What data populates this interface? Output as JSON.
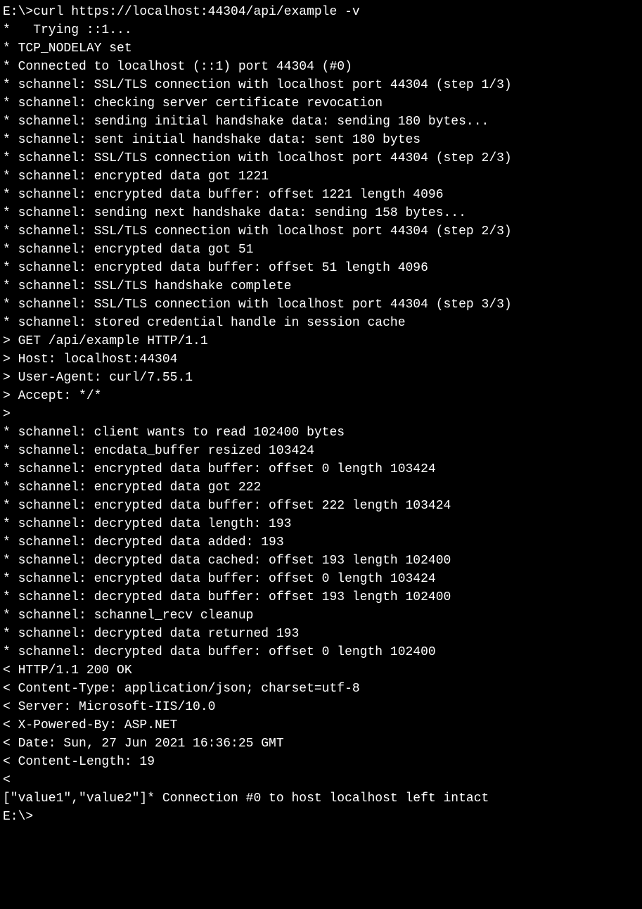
{
  "terminal": {
    "lines": [
      "E:\\>curl https://localhost:44304/api/example -v",
      "*   Trying ::1...",
      "* TCP_NODELAY set",
      "* Connected to localhost (::1) port 44304 (#0)",
      "* schannel: SSL/TLS connection with localhost port 44304 (step 1/3)",
      "* schannel: checking server certificate revocation",
      "* schannel: sending initial handshake data: sending 180 bytes...",
      "* schannel: sent initial handshake data: sent 180 bytes",
      "* schannel: SSL/TLS connection with localhost port 44304 (step 2/3)",
      "* schannel: encrypted data got 1221",
      "* schannel: encrypted data buffer: offset 1221 length 4096",
      "* schannel: sending next handshake data: sending 158 bytes...",
      "* schannel: SSL/TLS connection with localhost port 44304 (step 2/3)",
      "* schannel: encrypted data got 51",
      "* schannel: encrypted data buffer: offset 51 length 4096",
      "* schannel: SSL/TLS handshake complete",
      "* schannel: SSL/TLS connection with localhost port 44304 (step 3/3)",
      "* schannel: stored credential handle in session cache",
      "> GET /api/example HTTP/1.1",
      "> Host: localhost:44304",
      "> User-Agent: curl/7.55.1",
      "> Accept: */*",
      ">",
      "* schannel: client wants to read 102400 bytes",
      "* schannel: encdata_buffer resized 103424",
      "* schannel: encrypted data buffer: offset 0 length 103424",
      "* schannel: encrypted data got 222",
      "* schannel: encrypted data buffer: offset 222 length 103424",
      "* schannel: decrypted data length: 193",
      "* schannel: decrypted data added: 193",
      "* schannel: decrypted data cached: offset 193 length 102400",
      "* schannel: encrypted data buffer: offset 0 length 103424",
      "* schannel: decrypted data buffer: offset 193 length 102400",
      "* schannel: schannel_recv cleanup",
      "* schannel: decrypted data returned 193",
      "* schannel: decrypted data buffer: offset 0 length 102400",
      "< HTTP/1.1 200 OK",
      "< Content-Type: application/json; charset=utf-8",
      "< Server: Microsoft-IIS/10.0",
      "< X-Powered-By: ASP.NET",
      "< Date: Sun, 27 Jun 2021 16:36:25 GMT",
      "< Content-Length: 19",
      "<",
      "[\"value1\",\"value2\"]* Connection #0 to host localhost left intact",
      "",
      "E:\\>"
    ]
  }
}
